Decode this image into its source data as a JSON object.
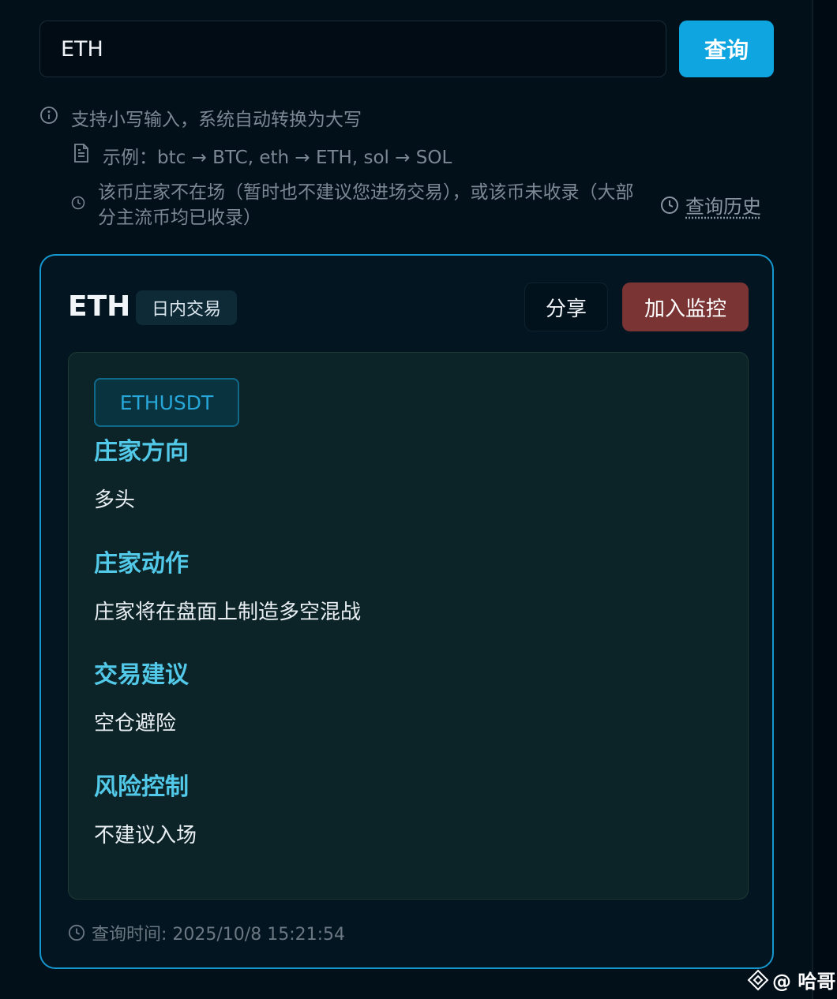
{
  "search": {
    "value": "ETH",
    "button_label": "查询"
  },
  "hints": {
    "lowercase": "支持小写输入，系统自动转换为大写",
    "example": "示例：btc → BTC, eth → ETH, sol → SOL",
    "notice": "该币庄家不在场（暂时也不建议您进场交易），或该币未收录（大部分主流币均已收录）",
    "history_link": "查询历史"
  },
  "result": {
    "coin": "ETH",
    "type_badge": "日内交易",
    "share_label": "分享",
    "monitor_label": "加入监控",
    "pair": "ETHUSDT",
    "sections": [
      {
        "title": "庄家方向",
        "value": "多头"
      },
      {
        "title": "庄家动作",
        "value": "庄家将在盘面上制造多空混战"
      },
      {
        "title": "交易建议",
        "value": "空仓避险"
      },
      {
        "title": "风险控制",
        "value": "不建议入场"
      }
    ],
    "query_time": "查询时间: 2025/10/8 15:21:54"
  },
  "watermark": "@ 哈哥",
  "colors": {
    "accent": "#0ea5e0",
    "monitor": "#7a3434",
    "section_title": "#52c9e8",
    "card_border": "#1596cf"
  }
}
